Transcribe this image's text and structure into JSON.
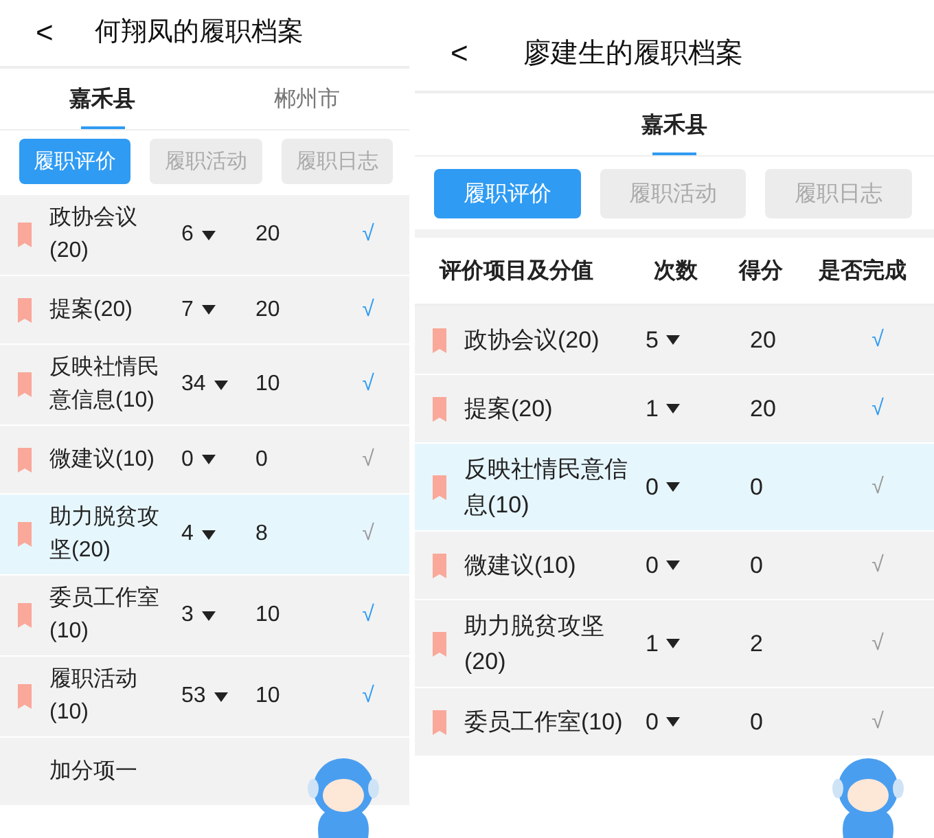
{
  "panels": [
    {
      "title": "何翔凤的履职档案",
      "back": "<",
      "tabs": [
        {
          "label": "嘉禾县",
          "selected": true
        },
        {
          "label": "郴州市",
          "selected": false
        }
      ],
      "segments": [
        {
          "label": "履职评价",
          "selected": true
        },
        {
          "label": "履职活动",
          "selected": false
        },
        {
          "label": "履职日志",
          "selected": false
        }
      ],
      "rows": [
        {
          "item": "政协会议(20)",
          "count": "6",
          "score": "20",
          "mark": "√",
          "done": true,
          "selected": false
        },
        {
          "item": "提案(20)",
          "count": "7",
          "score": "20",
          "mark": "√",
          "done": true,
          "selected": false
        },
        {
          "item": "反映社情民意信息(10)",
          "count": "34",
          "score": "10",
          "mark": "√",
          "done": true,
          "selected": false
        },
        {
          "item": "微建议(10)",
          "count": "0",
          "score": "0",
          "mark": "√",
          "done": false,
          "selected": false
        },
        {
          "item": "助力脱贫攻坚(20)",
          "count": "4",
          "score": "8",
          "mark": "√",
          "done": false,
          "selected": true
        },
        {
          "item": "委员工作室(10)",
          "count": "3",
          "score": "10",
          "mark": "√",
          "done": true,
          "selected": false
        },
        {
          "item": "履职活动(10)",
          "count": "53",
          "score": "10",
          "mark": "√",
          "done": true,
          "selected": false
        },
        {
          "item": "加分项一",
          "selected": false
        }
      ]
    },
    {
      "title": "廖建生的履职档案",
      "back": "<",
      "tabs": [
        {
          "label": "嘉禾县",
          "selected": true
        }
      ],
      "segments": [
        {
          "label": "履职评价",
          "selected": true
        },
        {
          "label": "履职活动",
          "selected": false
        },
        {
          "label": "履职日志",
          "selected": false
        }
      ],
      "columns": [
        "评价项目及分值",
        "次数",
        "得分",
        "是否完成"
      ],
      "rows": [
        {
          "item": "政协会议(20)",
          "count": "5",
          "score": "20",
          "mark": "√",
          "done": true,
          "selected": false
        },
        {
          "item": "提案(20)",
          "count": "1",
          "score": "20",
          "mark": "√",
          "done": true,
          "selected": false
        },
        {
          "item": "反映社情民意信息(10)",
          "count": "0",
          "score": "0",
          "mark": "√",
          "done": false,
          "selected": true
        },
        {
          "item": "微建议(10)",
          "count": "0",
          "score": "0",
          "mark": "√",
          "done": false,
          "selected": false
        },
        {
          "item": "助力脱贫攻坚(20)",
          "count": "1",
          "score": "2",
          "mark": "√",
          "done": false,
          "selected": false
        },
        {
          "item": "委员工作室(10)",
          "count": "0",
          "score": "0",
          "mark": "√",
          "done": false,
          "selected": false
        }
      ]
    }
  ]
}
